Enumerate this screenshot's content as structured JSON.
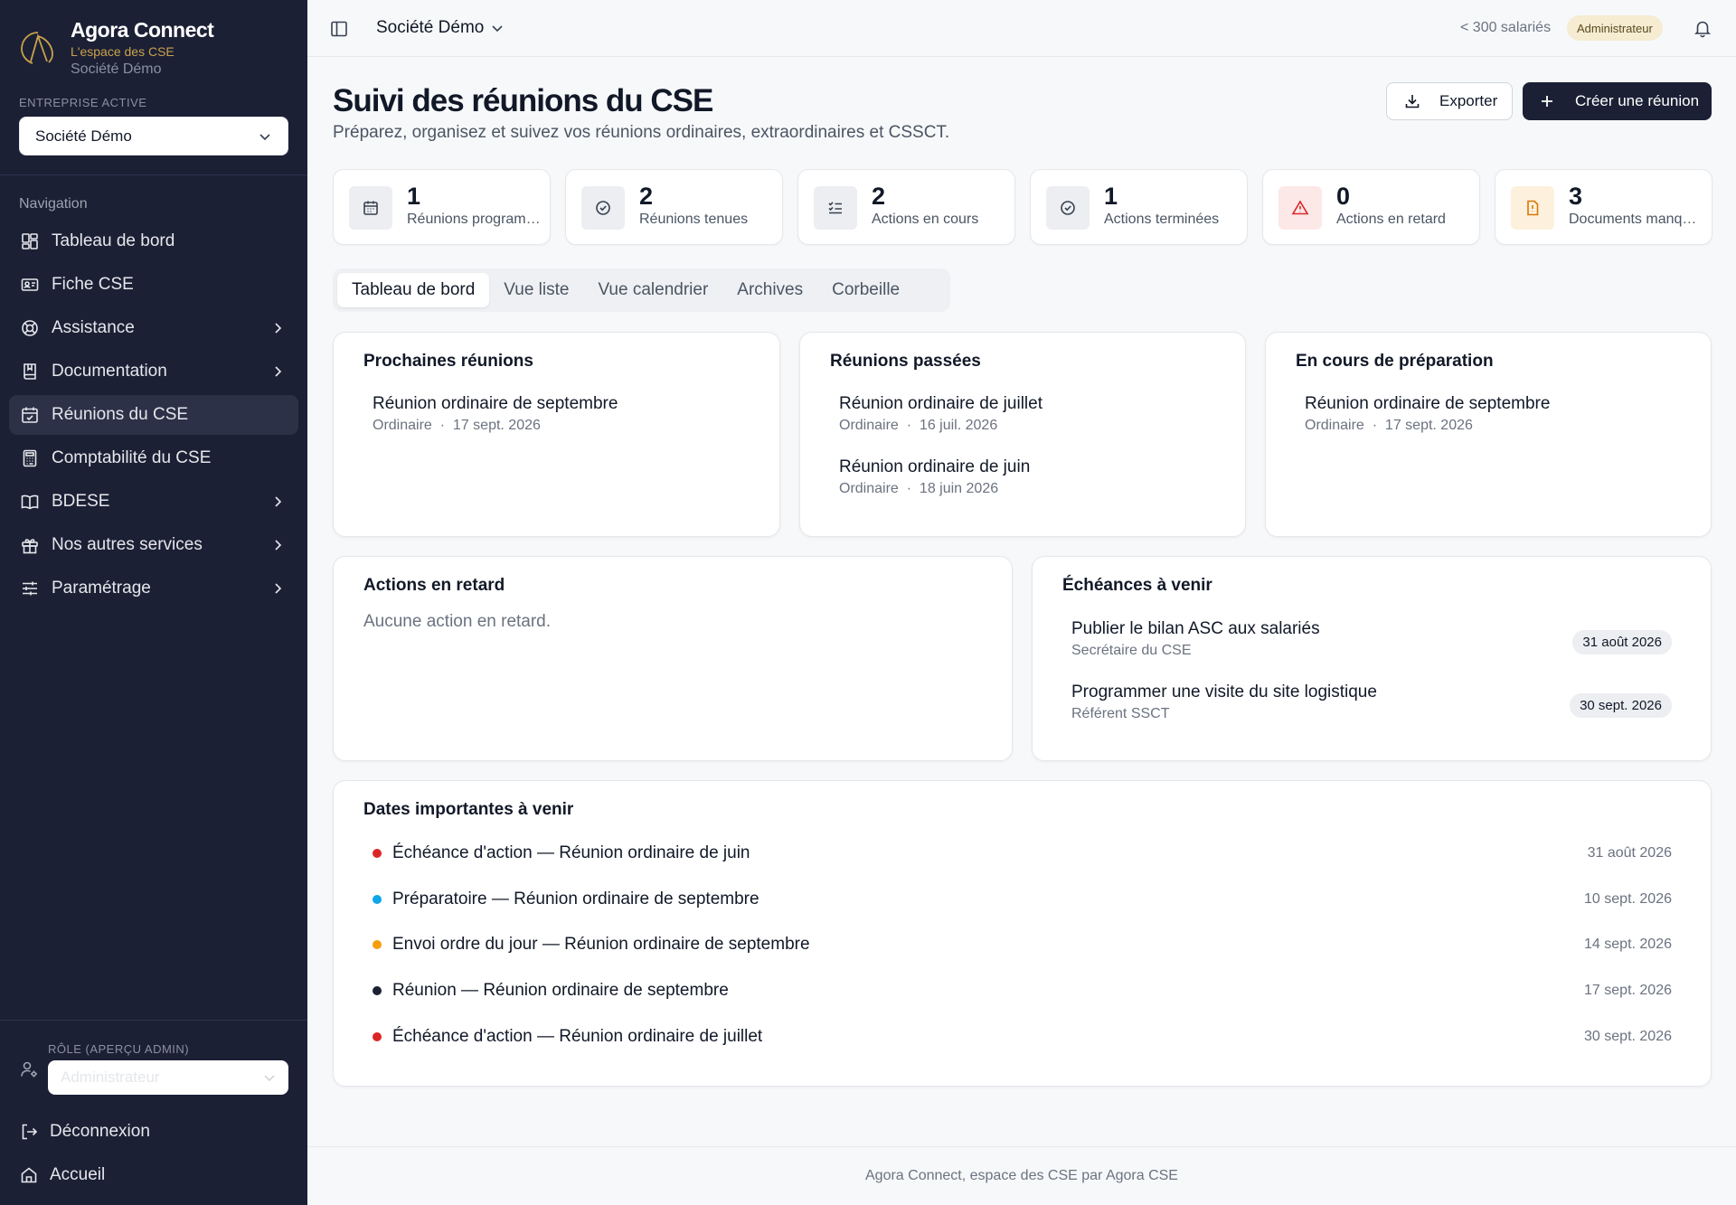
{
  "brand": {
    "title": "Agora Connect",
    "tagline": "L'espace des CSE",
    "company": "Société Démo",
    "accent": "#c9a24b"
  },
  "sidebar": {
    "enterprise_label": "ENTREPRISE ACTIVE",
    "enterprise_value": "Société Démo",
    "nav_label": "Navigation",
    "items": [
      {
        "label": "Tableau de bord",
        "icon": "dashboard-icon",
        "has_submenu": false,
        "active": false
      },
      {
        "label": "Fiche CSE",
        "icon": "id-card-icon",
        "has_submenu": false,
        "active": false
      },
      {
        "label": "Assistance",
        "icon": "lifebuoy-icon",
        "has_submenu": true,
        "active": false
      },
      {
        "label": "Documentation",
        "icon": "book-icon",
        "has_submenu": true,
        "active": false
      },
      {
        "label": "Réunions du CSE",
        "icon": "calendar-icon",
        "has_submenu": false,
        "active": true
      },
      {
        "label": "Comptabilité du CSE",
        "icon": "calculator-icon",
        "has_submenu": false,
        "active": false
      },
      {
        "label": "BDESE",
        "icon": "open-book-icon",
        "has_submenu": true,
        "active": false
      },
      {
        "label": "Nos autres services",
        "icon": "gift-icon",
        "has_submenu": true,
        "active": false
      },
      {
        "label": "Paramétrage",
        "icon": "sliders-icon",
        "has_submenu": true,
        "active": false
      }
    ],
    "role_label": "RÔLE (APERÇU ADMIN)",
    "role_value": "Administrateur",
    "logout": "Déconnexion",
    "home": "Accueil",
    "bg_color": "#1c2035"
  },
  "topbar": {
    "company": "Société Démo",
    "employee_count": "< 300 salariés",
    "role_badge": "Administrateur"
  },
  "header": {
    "title": "Suivi des réunions du CSE",
    "subtitle": "Préparez, organisez et suivez vos réunions ordinaires, extraordinaires et CSSCT.",
    "export_label": "Exporter",
    "create_label": "Créer une réunion"
  },
  "kpis": [
    {
      "value": "1",
      "label": "Réunions programmées",
      "icon": "calendar-icon",
      "tone": "neutral"
    },
    {
      "value": "2",
      "label": "Réunions tenues",
      "icon": "check-circle-icon",
      "tone": "neutral"
    },
    {
      "value": "2",
      "label": "Actions en cours",
      "icon": "checklist-icon",
      "tone": "neutral"
    },
    {
      "value": "1",
      "label": "Actions terminées",
      "icon": "check-circle-icon",
      "tone": "neutral"
    },
    {
      "value": "0",
      "label": "Actions en retard",
      "icon": "warning-icon",
      "tone": "red"
    },
    {
      "value": "3",
      "label": "Documents manquants",
      "icon": "alert-file-icon",
      "tone": "amber"
    }
  ],
  "tabs": [
    "Tableau de bord",
    "Vue liste",
    "Vue calendrier",
    "Archives",
    "Corbeille"
  ],
  "upcoming": {
    "title": "Prochaines réunions",
    "items": [
      {
        "title": "Réunion ordinaire de septembre",
        "type": "Ordinaire",
        "date": "17 sept. 2026"
      }
    ]
  },
  "past": {
    "title": "Réunions passées",
    "items": [
      {
        "title": "Réunion ordinaire de juillet",
        "type": "Ordinaire",
        "date": "16 juil. 2026"
      },
      {
        "title": "Réunion ordinaire de juin",
        "type": "Ordinaire",
        "date": "18 juin 2026"
      }
    ]
  },
  "preparing": {
    "title": "En cours de préparation",
    "items": [
      {
        "title": "Réunion ordinaire de septembre",
        "type": "Ordinaire",
        "date": "17 sept. 2026"
      }
    ]
  },
  "late_actions": {
    "title": "Actions en retard",
    "empty": "Aucune action en retard."
  },
  "deadlines": {
    "title": "Échéances à venir",
    "items": [
      {
        "title": "Publier le bilan ASC aux salariés",
        "owner": "Secrétaire du CSE",
        "date": "31 août 2026"
      },
      {
        "title": "Programmer une visite du site logistique",
        "owner": "Référent SSCT",
        "date": "30 sept. 2026"
      }
    ]
  },
  "important_dates": {
    "title": "Dates importantes à venir",
    "items": [
      {
        "label": "Échéance d'action — Réunion ordinaire de juin",
        "date": "31 août 2026",
        "color": "#dc2626"
      },
      {
        "label": "Préparatoire — Réunion ordinaire de septembre",
        "date": "10 sept. 2026",
        "color": "#0ea5e9"
      },
      {
        "label": "Envoi ordre du jour — Réunion ordinaire de septembre",
        "date": "14 sept. 2026",
        "color": "#f59e0b"
      },
      {
        "label": "Réunion — Réunion ordinaire de septembre",
        "date": "17 sept. 2026",
        "color": "#1c2035"
      },
      {
        "label": "Échéance d'action — Réunion ordinaire de juillet",
        "date": "30 sept. 2026",
        "color": "#dc2626"
      }
    ]
  },
  "footer": "Agora Connect, espace des CSE par Agora CSE"
}
